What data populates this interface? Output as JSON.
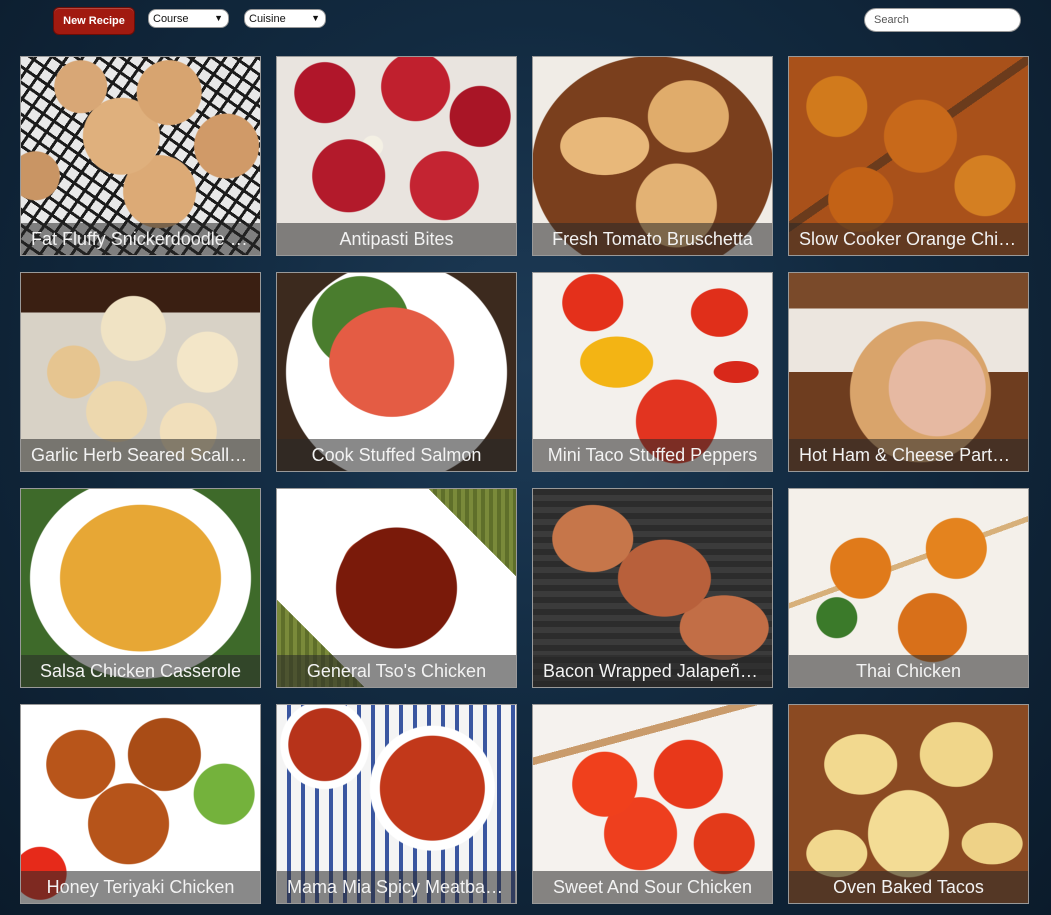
{
  "toolbar": {
    "new_recipe_label": "New Recipe",
    "course_select": "Course",
    "cuisine_select": "Cuisine",
    "search_placeholder": "Search"
  },
  "recipes": [
    {
      "title": "Fat Fluffy Snickerdoodle Cookies"
    },
    {
      "title": "Antipasti Bites"
    },
    {
      "title": "Fresh Tomato Bruschetta"
    },
    {
      "title": "Slow Cooker Orange Chicken"
    },
    {
      "title": "Garlic Herb Seared Scallops"
    },
    {
      "title": "Cook Stuffed Salmon"
    },
    {
      "title": "Mini Taco Stuffed Peppers"
    },
    {
      "title": "Hot Ham & Cheese Party Rolls"
    },
    {
      "title": "Salsa Chicken Casserole"
    },
    {
      "title": "General Tso's Chicken"
    },
    {
      "title": "Bacon Wrapped Jalapeño Chicken"
    },
    {
      "title": "Thai Chicken"
    },
    {
      "title": "Honey Teriyaki Chicken"
    },
    {
      "title": "Mama Mia Spicy Meatball Soup"
    },
    {
      "title": "Sweet And Sour Chicken"
    },
    {
      "title": "Oven Baked Tacos"
    }
  ],
  "colors": {
    "new_recipe_bg": "#a11a10",
    "page_bg": "#122a40"
  }
}
